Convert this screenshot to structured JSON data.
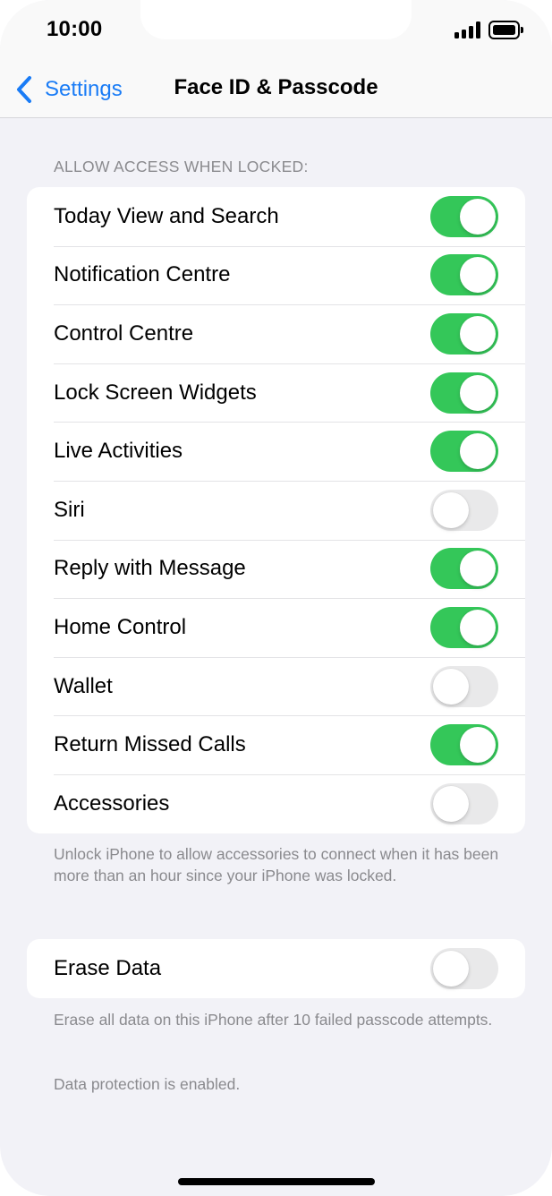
{
  "status_bar": {
    "time": "10:00"
  },
  "nav": {
    "back_label": "Settings",
    "title": "Face ID & Passcode"
  },
  "section": {
    "header": "ALLOW ACCESS WHEN LOCKED:",
    "footer": "Unlock iPhone to allow accessories to connect when it has been more than an hour since your iPhone was locked."
  },
  "items": [
    {
      "label": "Today View and Search",
      "on": true
    },
    {
      "label": "Notification Centre",
      "on": true
    },
    {
      "label": "Control Centre",
      "on": true
    },
    {
      "label": "Lock Screen Widgets",
      "on": true
    },
    {
      "label": "Live Activities",
      "on": true
    },
    {
      "label": "Siri",
      "on": false
    },
    {
      "label": "Reply with Message",
      "on": true
    },
    {
      "label": "Home Control",
      "on": true
    },
    {
      "label": "Wallet",
      "on": false
    },
    {
      "label": "Return Missed Calls",
      "on": true
    },
    {
      "label": "Accessories",
      "on": false
    }
  ],
  "erase": {
    "label": "Erase Data",
    "on": false,
    "footer": "Erase all data on this iPhone after 10 failed passcode attempts.",
    "footer2": "Data protection is enabled."
  },
  "colors": {
    "accent": "#1a7cf6",
    "toggle_on": "#34c759",
    "toggle_off": "#e9e9ea",
    "background": "#f2f2f7"
  },
  "icons": {
    "back": "chevron-left-icon",
    "signal": "cellular-signal-icon",
    "battery": "battery-icon"
  }
}
